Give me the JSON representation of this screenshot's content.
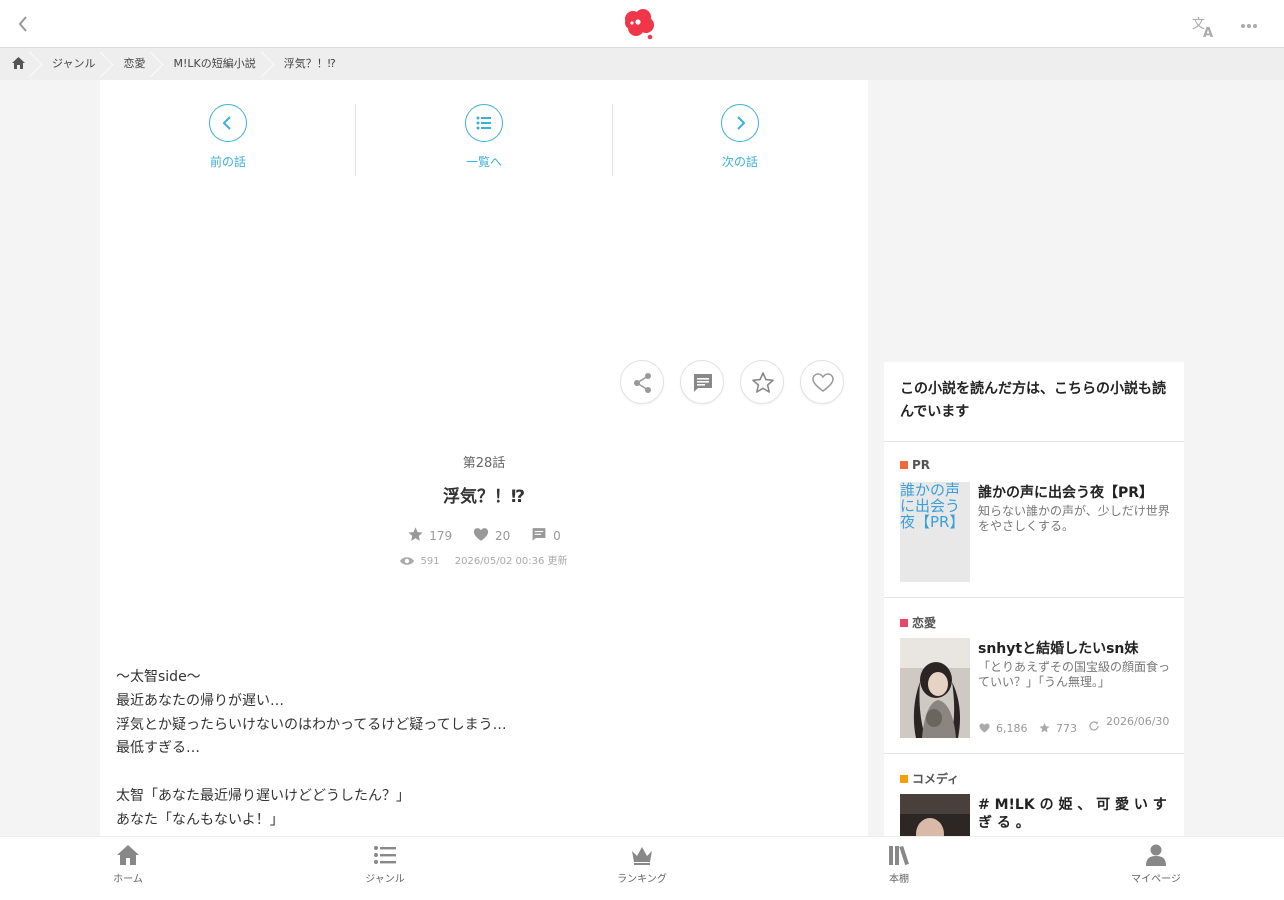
{
  "header": {
    "back_icon": "chevron-left-icon",
    "logo": "app-logo",
    "translate_icon": "translate-icon",
    "more_icon": "more-dots-icon"
  },
  "breadcrumb": {
    "home_icon": "home-icon",
    "items": [
      "ジャンル",
      "恋愛",
      "M!LKの短編小説",
      "浮気？！⁉"
    ]
  },
  "episode_nav": {
    "prev_label": "前の話",
    "list_label": "一覧へ",
    "next_label": "次の話"
  },
  "actions": [
    "share-icon",
    "comment-icon",
    "star-icon",
    "heart-icon"
  ],
  "episode": {
    "number": "第28話",
    "title": "浮気？！⁉",
    "stars": "179",
    "hearts": "20",
    "comments": "0",
    "views": "591",
    "updated": "2026/05/02 00:36 更新"
  },
  "body_text": "〜太智side〜\n最近あなたの帰りが遅い…\n浮気とか疑ったらいけないのはわかってるけど疑ってしまう…\n最低すぎる…\n\n太智「あなた最近帰り遅いけどどうしたん？」\nあなた「なんもないよ！」",
  "sidebar": {
    "heading": "この小説を読んだ方は、こちらの小説も読んでいます",
    "recommendations": [
      {
        "tag": "PR",
        "tag_color": "#f06a3a",
        "thumb_alt": "誰かの声に出会う夜【PR】",
        "title": "誰かの声に出会う夜【PR】",
        "desc": "知らない誰かの声が、少しだけ世界をやさしくする。"
      },
      {
        "tag": "恋愛",
        "tag_color": "#e8456a",
        "title": "snhytと結婚したいsn妹",
        "desc": "「とりあえずその国宝級の顔面食っていい？」「うん無理。」",
        "likes": "6,186",
        "stars": "773",
        "updated": "2026/06/30"
      },
      {
        "tag": "コメディ",
        "tag_color": "#f5a000",
        "title": "# M!LK の 姫 、 可 愛 い す ぎ る 。"
      }
    ]
  },
  "bottom_nav": {
    "home": "ホーム",
    "genre": "ジャンル",
    "ranking": "ランキング",
    "bookshelf": "本棚",
    "mypage": "マイページ"
  }
}
